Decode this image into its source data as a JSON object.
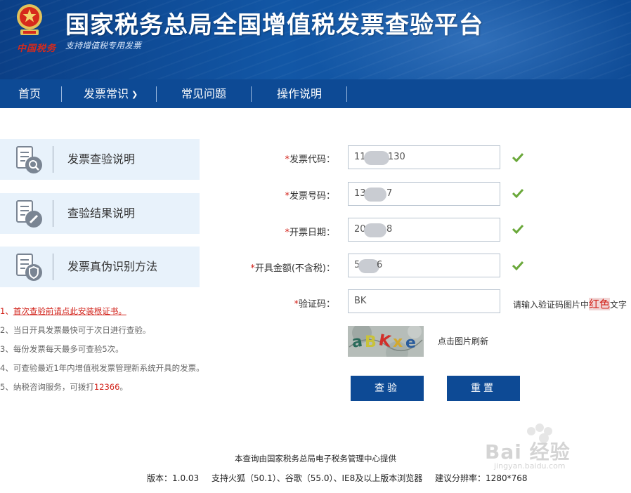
{
  "header": {
    "title": "国家税务总局全国增值税发票查验平台",
    "subtitle": "支持增值税专用发票",
    "logo_text": "中国税务"
  },
  "nav": {
    "items": [
      {
        "label": "首页"
      },
      {
        "label": "发票常识"
      },
      {
        "label": "常见问题"
      },
      {
        "label": "操作说明"
      }
    ]
  },
  "side_panels": [
    {
      "label": "发票查验说明",
      "icon": "search-doc-icon"
    },
    {
      "label": "查验结果说明",
      "icon": "edit-doc-icon"
    },
    {
      "label": "发票真伪识别方法",
      "icon": "shield-doc-icon"
    }
  ],
  "notes": {
    "n1_prefix": "1、",
    "n1_link": "首次查验前请点此安装根证书。",
    "n2": "2、当日开具发票最快可于次日进行查验。",
    "n3": "3、每份发票每天最多可查验5次。",
    "n4": "4、可查验最近1年内增值税发票管理新系统开具的发票。",
    "n5_prefix": "5、纳税咨询服务，可拨打",
    "n5_phone": "12366",
    "n5_suffix": "。"
  },
  "form": {
    "required_mark": "*",
    "fields": [
      {
        "label": "发票代码：",
        "value_start": "11",
        "value_end": "130"
      },
      {
        "label": "发票号码：",
        "value_start": "13",
        "value_end": "7"
      },
      {
        "label": "开票日期：",
        "value_start": "20",
        "value_end": "8"
      },
      {
        "label": "开具金额(不含税)：",
        "value_start": "5",
        "value_end": "6"
      }
    ],
    "captcha_label": "验证码：",
    "captcha_value": "BK",
    "captcha_hint_prefix": "请输入验证码图片中",
    "captcha_hint_red": "红色",
    "captcha_hint_suffix": "文字",
    "captcha_refresh": "点击图片刷新",
    "submit_label": "查验",
    "reset_label": "重置"
  },
  "footer": {
    "provider": "本查询由国家税务总局电子税务管理中心提供",
    "version_label": "版本：",
    "version": "1.0.03",
    "browsers": "支持火狐（50.1）、谷歌（55.0）、IE8及以上版本浏览器",
    "resolution": "建议分辨率：1280*768"
  },
  "watermark": {
    "text": "Bai 经验",
    "sub": "jingyan.baidu.com"
  },
  "colors": {
    "nav_blue": "#0d4a95",
    "banner_blue": "#1257a6",
    "required_red": "#d2221a",
    "check_green": "#6aa83a",
    "panel_bg": "#e8f2fb"
  }
}
